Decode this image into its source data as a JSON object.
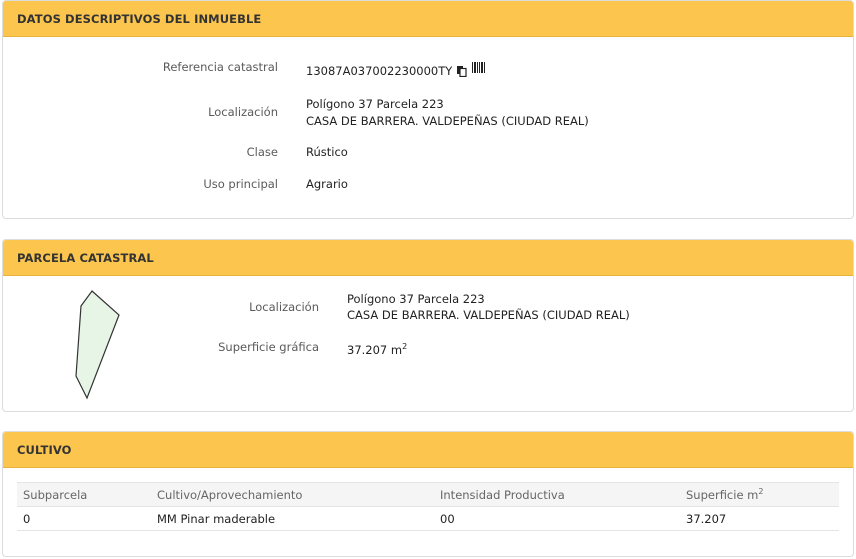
{
  "datos": {
    "title": "DATOS DESCRIPTIVOS DEL INMUEBLE",
    "ref_label": "Referencia catastral",
    "ref_value": "13087A037002230000TY",
    "loc_label": "Localización",
    "loc_line1": "Polígono 37 Parcela 223",
    "loc_line2": "CASA DE BARRERA. VALDEPEÑAS (CIUDAD REAL)",
    "clase_label": "Clase",
    "clase_value": "Rústico",
    "uso_label": "Uso principal",
    "uso_value": "Agrario"
  },
  "parcela": {
    "title": "PARCELA CATASTRAL",
    "loc_label": "Localización",
    "loc_line1": "Polígono 37 Parcela 223",
    "loc_line2": "CASA DE BARRERA. VALDEPEÑAS (CIUDAD REAL)",
    "sup_label": "Superficie gráfica",
    "sup_value": "37.207 m",
    "sup_unit_exp": "2",
    "shape_fill": "#e6f5e6",
    "shape_stroke": "#333333"
  },
  "cultivo": {
    "title": "CULTIVO",
    "headers": [
      "Subparcela",
      "Cultivo/Aprovechamiento",
      "Intensidad Productiva",
      "Superficie m"
    ],
    "header_exp": "2",
    "rows": [
      [
        "0",
        "MM Pinar maderable",
        "00",
        "37.207"
      ]
    ]
  },
  "colors": {
    "header_bg": "#fcc54d",
    "border": "#dcdcdc"
  },
  "icons": [
    "copy-icon",
    "barcode-icon"
  ]
}
